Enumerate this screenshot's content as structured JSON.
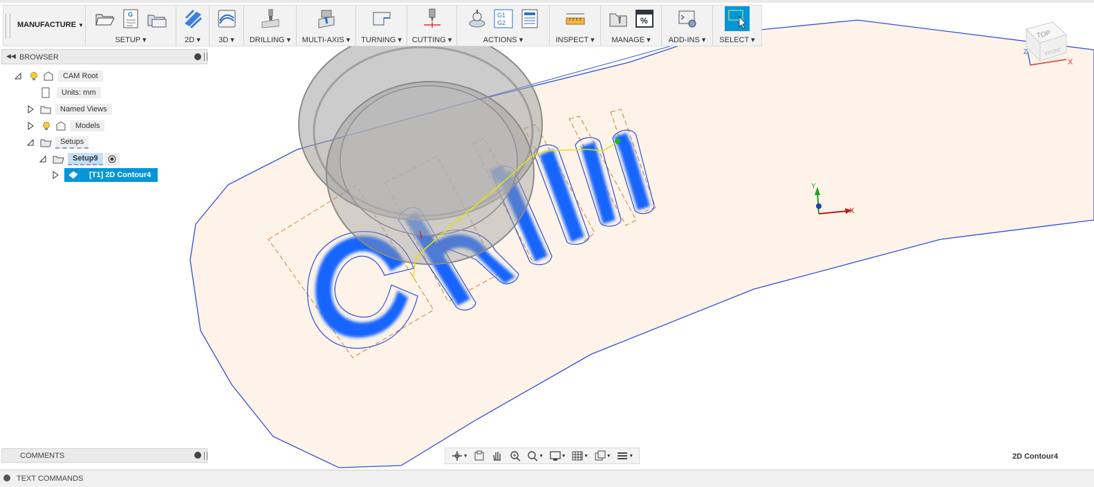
{
  "workspace": {
    "label": "MANUFACTURE"
  },
  "toolbar": {
    "groups": [
      {
        "label": "SETUP"
      },
      {
        "label": "2D"
      },
      {
        "label": "3D"
      },
      {
        "label": "DRILLING"
      },
      {
        "label": "MULTI-AXIS"
      },
      {
        "label": "TURNING"
      },
      {
        "label": "CUTTING"
      },
      {
        "label": "ACTIONS"
      },
      {
        "label": "INSPECT"
      },
      {
        "label": "MANAGE"
      },
      {
        "label": "ADD-INS"
      },
      {
        "label": "SELECT"
      }
    ],
    "icon_text": {
      "gcode": "G",
      "g1": "G1",
      "g2": "G2",
      "percent": "%"
    }
  },
  "browser": {
    "title": "BROWSER",
    "tree": [
      {
        "label": "CAM Root"
      },
      {
        "label": "Units: mm"
      },
      {
        "label": "Named Views"
      },
      {
        "label": "Models"
      },
      {
        "label": "Setups"
      },
      {
        "label": "Setup9"
      },
      {
        "label": "[T1] 2D Contour4"
      }
    ]
  },
  "comments": {
    "title": "COMMENTS"
  },
  "status": {
    "text": "2D Contour4"
  },
  "text_commands": {
    "label": "TEXT COMMANDS"
  },
  "viewcube": {
    "top": "TOP",
    "front": "FRONT",
    "x": "X",
    "z": "Z"
  },
  "triad": {
    "x": "X",
    "y": "Y"
  },
  "model": {
    "engraving_text": "Chilli"
  },
  "colors": {
    "toolpath": "#1565ff",
    "boundary": "#2f4fd8",
    "stock": "#fdf3e8",
    "tool_rapid": "#e4e400",
    "selection": "#0696d7",
    "dashed": "#d08a4a"
  }
}
